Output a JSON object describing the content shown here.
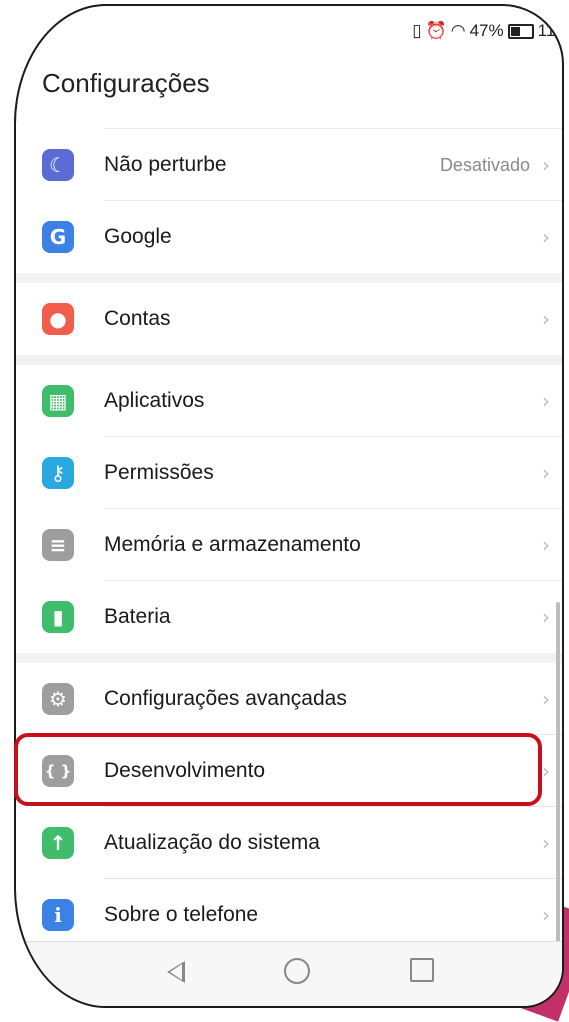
{
  "status_bar": {
    "battery": "47%",
    "time": "11:"
  },
  "header": {
    "title": "Configurações"
  },
  "sections": [
    {
      "items": [
        {
          "label": "Não perturbe",
          "value": "Desativado",
          "icon": "moon-icon",
          "color": "#5b6bd6"
        },
        {
          "label": "Google",
          "value": "",
          "icon": "google-icon",
          "color": "#3b82e4"
        }
      ]
    },
    {
      "items": [
        {
          "label": "Contas",
          "value": "",
          "icon": "account-icon",
          "color": "#f25d4c"
        }
      ]
    },
    {
      "items": [
        {
          "label": "Aplicativos",
          "value": "",
          "icon": "apps-grid-icon",
          "color": "#3fbd6b"
        },
        {
          "label": "Permissões",
          "value": "",
          "icon": "key-icon",
          "color": "#29a9e0"
        },
        {
          "label": "Memória e armazenamento",
          "value": "",
          "icon": "storage-icon",
          "color": "#9e9e9e"
        },
        {
          "label": "Bateria",
          "value": "",
          "icon": "battery-icon",
          "color": "#3fbd6b"
        }
      ]
    },
    {
      "items": [
        {
          "label": "Configurações avançadas",
          "value": "",
          "icon": "gear-icon",
          "color": "#9e9e9e"
        },
        {
          "label": "Desenvolvimento",
          "value": "",
          "icon": "braces-icon",
          "color": "#9e9e9e"
        },
        {
          "label": "Atualização do sistema",
          "value": "",
          "icon": "system-update-icon",
          "color": "#3fbd6b"
        },
        {
          "label": "Sobre o telefone",
          "value": "",
          "icon": "info-icon",
          "color": "#3b82e4"
        }
      ]
    }
  ],
  "glyphs": {
    "moon": "☾",
    "google": "G",
    "account": "●",
    "apps": "▦",
    "key": "⚷",
    "storage": "≡",
    "battery": "▮",
    "gear": "⚙",
    "braces": "{ }",
    "update": "↑",
    "info": "i",
    "chevron": "›"
  }
}
